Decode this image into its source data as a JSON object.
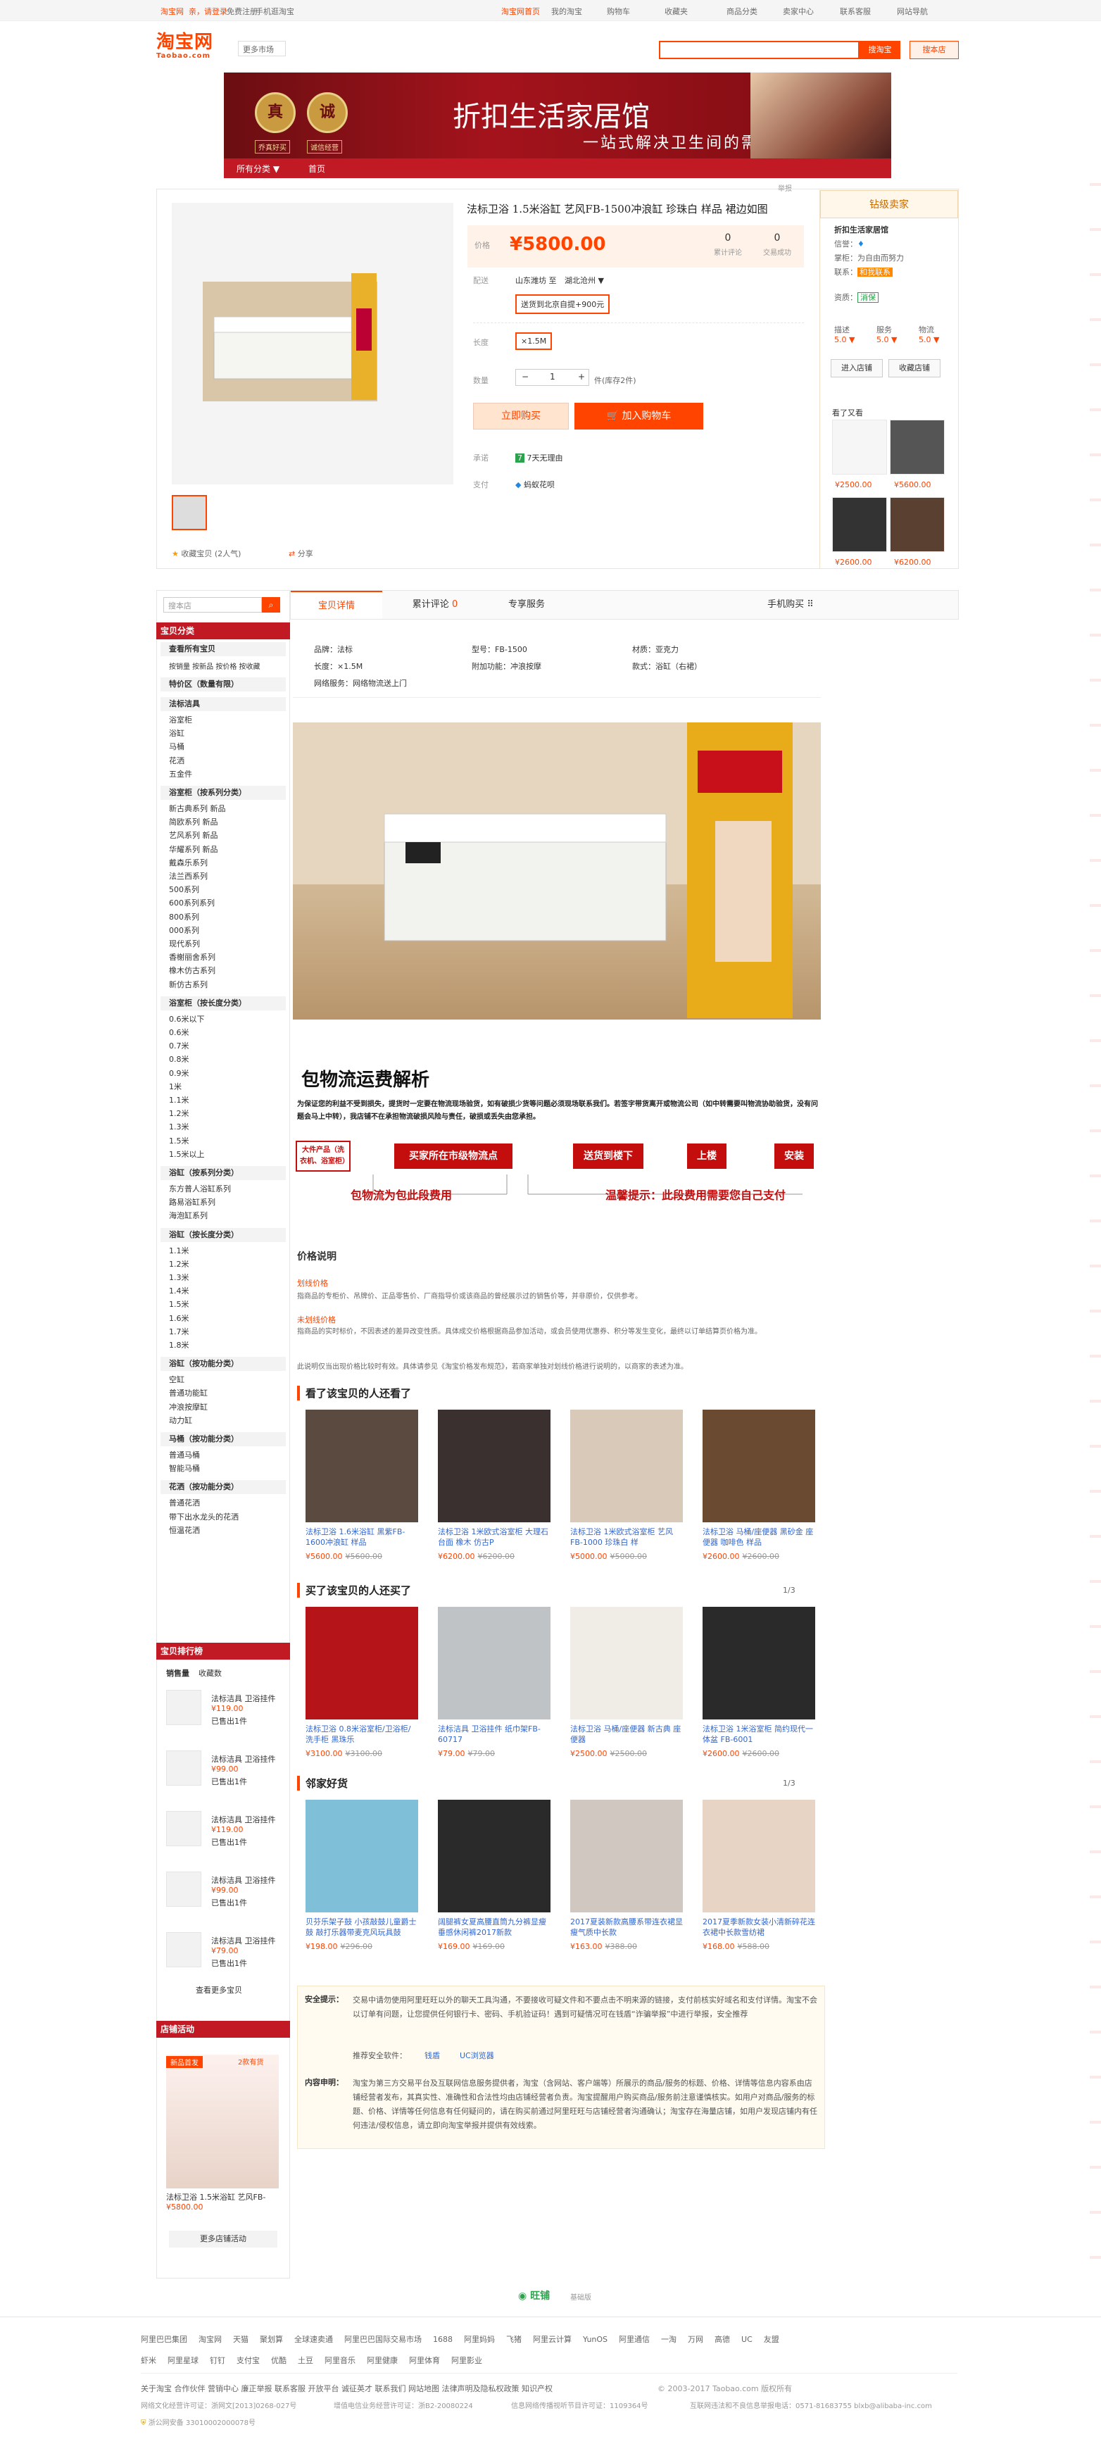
{
  "topbar": {
    "brand": "淘宝网",
    "login": "亲，请登录",
    "register": "免费注册",
    "mobile": "手机逛淘宝",
    "home": "淘宝网首页",
    "my": "我的淘宝",
    "cart": "购物车",
    "fav": "收藏夹",
    "category": "商品分类",
    "seller": "卖家中心",
    "service": "联系客服",
    "sitemap": "网站导航"
  },
  "header": {
    "logo_cn": "淘宝网",
    "logo_en": "Taobao.com",
    "market": "更多市场",
    "search_btn": "搜淘宝",
    "search_shop": "搜本店"
  },
  "banner": {
    "title": "折扣生活家居馆",
    "subtitle": "一站式解决卫生间的需求",
    "seal1": "真",
    "seal2": "诚",
    "tag1": "乔真好买",
    "tag2": "诚信经营",
    "nav_all": "所有分类 ▼",
    "nav_home": "首页",
    "report": "举报"
  },
  "product": {
    "title": "法标卫浴 1.5米浴缸 艺风FB-1500冲浪缸 珍珠白 样品 裙边如图",
    "price_label": "价格",
    "price": "¥5800.00",
    "reviews": "0",
    "reviews_label": "累计评论",
    "trades": "0",
    "trades_label": "交易成功",
    "ship_label": "配送",
    "ship_from": "山东潍坊 至",
    "ship_to": "湖北沧州 ▼",
    "ship_opt": "送货到北京自提+900元",
    "len_label": "长度",
    "len_opt": "×1.5M",
    "qty_label": "数量",
    "qty_minus": "−",
    "qty_val": "1",
    "qty_plus": "+",
    "qty_unit": "件(库存2件)",
    "buy_now": "立即购买",
    "add_cart": "加入购物车",
    "promise_label": "承诺",
    "promise": "7天无理由",
    "pay_label": "支付",
    "pay": "蚂蚁花呗",
    "fav": "收藏宝贝 (2人气)",
    "share": "分享"
  },
  "seller": {
    "level": "钻级卖家",
    "name": "折扣生活家居馆",
    "rank": "信誉：",
    "keeper": "掌柜：",
    "keeper_name": "为自由而努力",
    "contact": "联系：",
    "contact_btn": "和我联系",
    "qual": "资质：",
    "qual_val": "消保",
    "desc": "描述",
    "svc": "服务",
    "logi": "物流",
    "desc_v": "5.0 ▼",
    "svc_v": "5.0 ▼",
    "logi_v": "5.0 ▼",
    "enter": "进入店铺",
    "fav_shop": "收藏店铺",
    "related": "看了又看",
    "rel_prices": [
      "¥2500.00",
      "¥5600.00",
      "¥2600.00",
      "¥6200.00"
    ]
  },
  "sidebar": {
    "search_placeholder": "搜本店",
    "cat_title": "宝贝分类",
    "view_all": "查看所有宝贝",
    "sort": "按销量 按新品 按价格 按收藏",
    "special": "特价区（数量有限）",
    "groups": [
      {
        "title": "法标洁具",
        "items": [
          "浴室柜",
          "浴缸",
          "马桶",
          "花洒",
          "五金件"
        ]
      },
      {
        "title": "浴室柜（按系列分类）",
        "items": [
          "新古典系列 新品",
          "简欧系列 新品",
          "艺风系列 新品",
          "华耀系列 新品",
          "戴森乐系列",
          "法兰西系列",
          "500系列",
          "600系列系列",
          "800系列",
          "000系列",
          "现代系列",
          "香榭丽舍系列",
          "橡木仿古系列",
          "新仿古系列"
        ]
      },
      {
        "title": "浴室柜（按长度分类）",
        "items": [
          "0.6米以下",
          "0.6米",
          "0.7米",
          "0.8米",
          "0.9米",
          "1米",
          "1.1米",
          "1.2米",
          "1.3米",
          "1.5米",
          "1.5米以上"
        ]
      },
      {
        "title": "浴缸（按系列分类）",
        "items": [
          "东方普人浴缸系列",
          "路易浴缸系列",
          "海泡缸系列"
        ]
      },
      {
        "title": "浴缸（按长度分类）",
        "items": [
          "1.1米",
          "1.2米",
          "1.3米",
          "1.4米",
          "1.5米",
          "1.6米",
          "1.7米",
          "1.8米"
        ]
      },
      {
        "title": "浴缸（按功能分类）",
        "items": [
          "空缸",
          "普通功能缸",
          "冲浪按摩缸",
          "动力缸"
        ]
      },
      {
        "title": "马桶（按功能分类）",
        "items": [
          "普通马桶",
          "智能马桶"
        ]
      },
      {
        "title": "花洒（按功能分类）",
        "items": [
          "普通花洒",
          "带下出水龙头的花洒",
          "恒温花洒"
        ]
      }
    ],
    "rank_title": "宝贝排行榜",
    "rank_tab1": "销售量",
    "rank_tab2": "收藏数",
    "rank_items": [
      {
        "name": "法标洁具 卫浴挂件",
        "price": "¥119.00",
        "sold": "已售出1件"
      },
      {
        "name": "法标洁具 卫浴挂件",
        "price": "¥99.00",
        "sold": "已售出1件"
      },
      {
        "name": "法标洁具 卫浴挂件",
        "price": "¥119.00",
        "sold": "已售出1件"
      },
      {
        "name": "法标洁具 卫浴挂件",
        "price": "¥99.00",
        "sold": "已售出1件"
      },
      {
        "name": "法标洁具 卫浴挂件",
        "price": "¥79.00",
        "sold": "已售出1件"
      }
    ],
    "rank_more": "查看更多宝贝",
    "promo_title": "店铺活动",
    "promo_tag1": "新品首发",
    "promo_tag2": "2款有货",
    "promo_name": "法标卫浴 1.5米浴缸 艺风FB-",
    "promo_price": "¥5800.00",
    "promo_more": "更多店铺活动"
  },
  "tabs": {
    "detail": "宝贝详情",
    "reviews": "累计评论",
    "reviews_n": "0",
    "service": "专享服务",
    "mobile": "手机购买 ⠿"
  },
  "attrs": [
    [
      "品牌：法标",
      "型号：FB-1500",
      "材质：亚克力"
    ],
    [
      "长度：×1.5M",
      "附加功能：冲浪按摩",
      "款式：浴缸（右裙）"
    ],
    [
      "网络服务：网络物流送上门",
      "",
      ""
    ]
  ],
  "shipping": {
    "title": "包物流运费解析",
    "desc": "为保证您的利益不受到损失，提货时一定要在物流现场验货，如有破损少货等问题必须现场联系我们。若签字带货离开或物流公司（如中转需要叫物流协助验货，没有问题会马上中转），我店铺不在承担物流破损风险与责任，破损或丢失由您承担。",
    "box1": "大件产品（洗衣机、浴室柜）",
    "box2": "买家所在市级物流点",
    "box3": "送货到楼下",
    "box4": "上楼",
    "box5": "安装",
    "note1": "包物流为包此段费用",
    "note2": "温馨提示：此段费用需要您自己支付"
  },
  "price_desc": {
    "title": "价格说明",
    "t1": "划线价格",
    "d1": "指商品的专柜价、吊牌价、正品零售价、厂商指导价或该商品的曾经展示过的销售价等，并非原价，仅供参考。",
    "t2": "未划线价格",
    "d2": "指商品的实时标价，不因表述的差异改变性质。具体成交价格根据商品参加活动，或会员使用优惠券、积分等发生变化，最终以订单结算页价格为准。",
    "d3": "此说明仅当出现价格比较时有效。具体请参见《淘宝价格发布规范》，若商家单独对划线价格进行说明的，以商家的表述为准。"
  },
  "sections": [
    {
      "title": "看了该宝贝的人还看了",
      "pager": "",
      "items": [
        {
          "name": "法标卫浴 1.6米浴缸 黑紫FB-1600冲浪缸 样品",
          "price": "¥5600.00",
          "orig": "¥5600.00"
        },
        {
          "name": "法标卫浴 1米欧式浴室柜 大理石台面 橡木 仿古P",
          "price": "¥6200.00",
          "orig": "¥6200.00"
        },
        {
          "name": "法标卫浴 1米欧式浴室柜 艺风FB-1000 珍珠白 样",
          "price": "¥5000.00",
          "orig": "¥5000.00"
        },
        {
          "name": "法标卫浴 马桶/座便器 黑砂金 座便器 咖啡色 样品",
          "price": "¥2600.00",
          "orig": "¥2600.00"
        }
      ]
    },
    {
      "title": "买了该宝贝的人还买了",
      "pager": "1/3",
      "items": [
        {
          "name": "法标卫浴 0.8米浴室柜/卫浴柜/洗手柜 黑珠乐",
          "price": "¥3100.00",
          "orig": "¥3100.00"
        },
        {
          "name": "法标洁具 卫浴挂件 纸巾架FB-60717",
          "price": "¥79.00",
          "orig": "¥79.00"
        },
        {
          "name": "法标卫浴 马桶/座便器 新古典 座便器",
          "price": "¥2500.00",
          "orig": "¥2500.00"
        },
        {
          "name": "法标卫浴 1米浴室柜 简约现代一体盆 FB-6001",
          "price": "¥2600.00",
          "orig": "¥2600.00"
        }
      ]
    },
    {
      "title": "邻家好货",
      "pager": "1/3",
      "items": [
        {
          "name": "贝芬乐架子鼓 小孩敲鼓儿童爵士鼓 敲打乐器带麦克风玩具鼓",
          "price": "¥198.00",
          "orig": "¥296.00"
        },
        {
          "name": "阔腿裤女夏高腰直筒九分裤显瘦垂感休闲裤2017新款",
          "price": "¥169.00",
          "orig": "¥169.00"
        },
        {
          "name": "2017夏装新款高腰系带连衣裙显瘦气质中长款",
          "price": "¥163.00",
          "orig": "¥388.00"
        },
        {
          "name": "2017夏季新款女装小清新碎花连衣裙中长款雪纺裙",
          "price": "¥168.00",
          "orig": "¥588.00"
        }
      ]
    }
  ],
  "safety": {
    "l1": "安全提示：",
    "t1": "交易中请勿使用阿里旺旺以外的聊天工具沟通，不要接收可疑文件和不要点击不明来源的链接，支付前核实好域名和支付详情。淘宝不会以订单有问题，让您提供任何银行卡、密码、手机验证码！遇到可疑情况可在钱盾“诈骗举报”中进行举报，安全推荐",
    "sw_label": "推荐安全软件：",
    "sw1": "钱盾",
    "sw2": "UC浏览器",
    "l2": "内容申明：",
    "t2": "淘宝为第三方交易平台及互联网信息服务提供者，淘宝（含网站、客户端等）所展示的商品/服务的标题、价格、详情等信息内容系由店铺经营者发布，其真实性、准确性和合法性均由店铺经营者负责。淘宝提醒用户购买商品/服务前注意谨慎核实。如用户对商品/服务的标题、价格、详情等任何信息有任何疑问的，请在购买前通过阿里旺旺与店铺经营者沟通确认；淘宝存在海量店铺，如用户发现店铺内有任何违法/侵权信息，请立即向淘宝举报并提供有效线索。"
  },
  "footer": {
    "wangpu": "旺铺",
    "wangpu_sub": "基础版",
    "links1": [
      "阿里巴巴集团",
      "淘宝网",
      "天猫",
      "聚划算",
      "全球速卖通",
      "阿里巴巴国际交易市场",
      "1688",
      "阿里妈妈",
      "飞猪",
      "阿里云计算",
      "YunOS",
      "阿里通信",
      "一淘",
      "万网",
      "高德",
      "UC",
      "友盟"
    ],
    "links2": [
      "虾米",
      "阿里星球",
      "钉钉",
      "支付宝",
      "优酷",
      "土豆",
      "阿里音乐",
      "阿里健康",
      "阿里体育",
      "阿里影业"
    ],
    "about": "关于淘宝 合作伙伴 营销中心 廉正举报 联系客服 开放平台 诚征英才 联系我们 网站地图 法律声明及隐私权政策 知识产权",
    "copyright": "© 2003-2017 Taobao.com 版权所有",
    "lic1": "网络文化经营许可证：浙网文[2013]0268-027号",
    "lic2": "增值电信业务经营许可证：浙B2-20080224",
    "lic3": "信息网络传播视听节目许可证：1109364号",
    "lic4": "互联网违法和不良信息举报电话：0571-81683755 blxb@alibaba-inc.com",
    "gov": "浙公网安备 33010002000078号"
  }
}
